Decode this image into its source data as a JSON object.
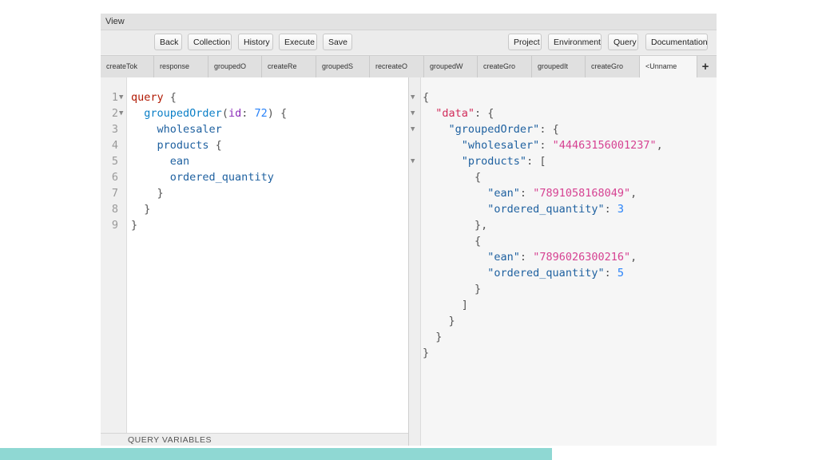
{
  "menu": {
    "view": "View"
  },
  "toolbar": {
    "left_buttons": [
      "Back",
      "Collection",
      "History",
      "Execute",
      "Save"
    ],
    "right_buttons": [
      "Project",
      "Environment",
      "Query",
      "Documentation"
    ]
  },
  "tabs": [
    "createTok",
    "response",
    "groupedO",
    "createRe",
    "groupedS",
    "recreateO",
    "groupedW",
    "createGro",
    "groupedIt",
    "createGro",
    "<Unname"
  ],
  "active_tab_index": 10,
  "add_tab": "+",
  "query_lines": [
    {
      "num": "1",
      "fold": "▼",
      "tokens": [
        [
          "k",
          "query"
        ],
        [
          "p",
          " {"
        ]
      ]
    },
    {
      "num": "2",
      "fold": "▼",
      "tokens": [
        [
          "p",
          "  "
        ],
        [
          "f",
          "groupedOrder"
        ],
        [
          "p",
          "("
        ],
        [
          "a",
          "id"
        ],
        [
          "p",
          ": "
        ],
        [
          "n",
          "72"
        ],
        [
          "p",
          ") {"
        ]
      ]
    },
    {
      "num": "3",
      "fold": "",
      "tokens": [
        [
          "p",
          "    "
        ],
        [
          "s",
          "wholesaler"
        ]
      ]
    },
    {
      "num": "4",
      "fold": "",
      "tokens": [
        [
          "p",
          "    "
        ],
        [
          "s",
          "products"
        ],
        [
          "p",
          " {"
        ]
      ]
    },
    {
      "num": "5",
      "fold": "",
      "tokens": [
        [
          "p",
          "      "
        ],
        [
          "s",
          "ean"
        ]
      ]
    },
    {
      "num": "6",
      "fold": "",
      "tokens": [
        [
          "p",
          "      "
        ],
        [
          "s",
          "ordered_quantity"
        ]
      ]
    },
    {
      "num": "7",
      "fold": "",
      "tokens": [
        [
          "p",
          "    }"
        ]
      ]
    },
    {
      "num": "8",
      "fold": "",
      "tokens": [
        [
          "p",
          "  }"
        ]
      ]
    },
    {
      "num": "9",
      "fold": "",
      "tokens": [
        [
          "p",
          "}"
        ]
      ]
    }
  ],
  "result_lines": [
    {
      "fold": "▼",
      "tokens": [
        [
          "p",
          "{"
        ]
      ]
    },
    {
      "fold": "▼",
      "tokens": [
        [
          "p",
          "  "
        ],
        [
          "jd",
          "\"data\""
        ],
        [
          "p",
          ": {"
        ]
      ]
    },
    {
      "fold": "▼",
      "tokens": [
        [
          "p",
          "    "
        ],
        [
          "jk",
          "\"groupedOrder\""
        ],
        [
          "p",
          ": {"
        ]
      ]
    },
    {
      "fold": "",
      "tokens": [
        [
          "p",
          "      "
        ],
        [
          "jk",
          "\"wholesaler\""
        ],
        [
          "p",
          ": "
        ],
        [
          "js",
          "\"44463156001237\""
        ],
        [
          "p",
          ","
        ]
      ]
    },
    {
      "fold": "▼",
      "tokens": [
        [
          "p",
          "      "
        ],
        [
          "jk",
          "\"products\""
        ],
        [
          "p",
          ": ["
        ]
      ]
    },
    {
      "fold": "",
      "tokens": [
        [
          "p",
          "        {"
        ]
      ]
    },
    {
      "fold": "",
      "tokens": [
        [
          "p",
          "          "
        ],
        [
          "jk",
          "\"ean\""
        ],
        [
          "p",
          ": "
        ],
        [
          "js",
          "\"7891058168049\""
        ],
        [
          "p",
          ","
        ]
      ]
    },
    {
      "fold": "",
      "tokens": [
        [
          "p",
          "          "
        ],
        [
          "jk",
          "\"ordered_quantity\""
        ],
        [
          "p",
          ": "
        ],
        [
          "jn",
          "3"
        ]
      ]
    },
    {
      "fold": "",
      "tokens": [
        [
          "p",
          "        },"
        ]
      ]
    },
    {
      "fold": "",
      "tokens": [
        [
          "p",
          "        {"
        ]
      ]
    },
    {
      "fold": "",
      "tokens": [
        [
          "p",
          "          "
        ],
        [
          "jk",
          "\"ean\""
        ],
        [
          "p",
          ": "
        ],
        [
          "js",
          "\"7896026300216\""
        ],
        [
          "p",
          ","
        ]
      ]
    },
    {
      "fold": "",
      "tokens": [
        [
          "p",
          "          "
        ],
        [
          "jk",
          "\"ordered_quantity\""
        ],
        [
          "p",
          ": "
        ],
        [
          "jn",
          "5"
        ]
      ]
    },
    {
      "fold": "",
      "tokens": [
        [
          "p",
          "        }"
        ]
      ]
    },
    {
      "fold": "",
      "tokens": [
        [
          "p",
          "      ]"
        ]
      ]
    },
    {
      "fold": "",
      "tokens": [
        [
          "p",
          "    }"
        ]
      ]
    },
    {
      "fold": "",
      "tokens": [
        [
          "p",
          "  }"
        ]
      ]
    },
    {
      "fold": "",
      "tokens": [
        [
          "p",
          "}"
        ]
      ]
    }
  ],
  "query_variables": "QUERY VARIABLES"
}
